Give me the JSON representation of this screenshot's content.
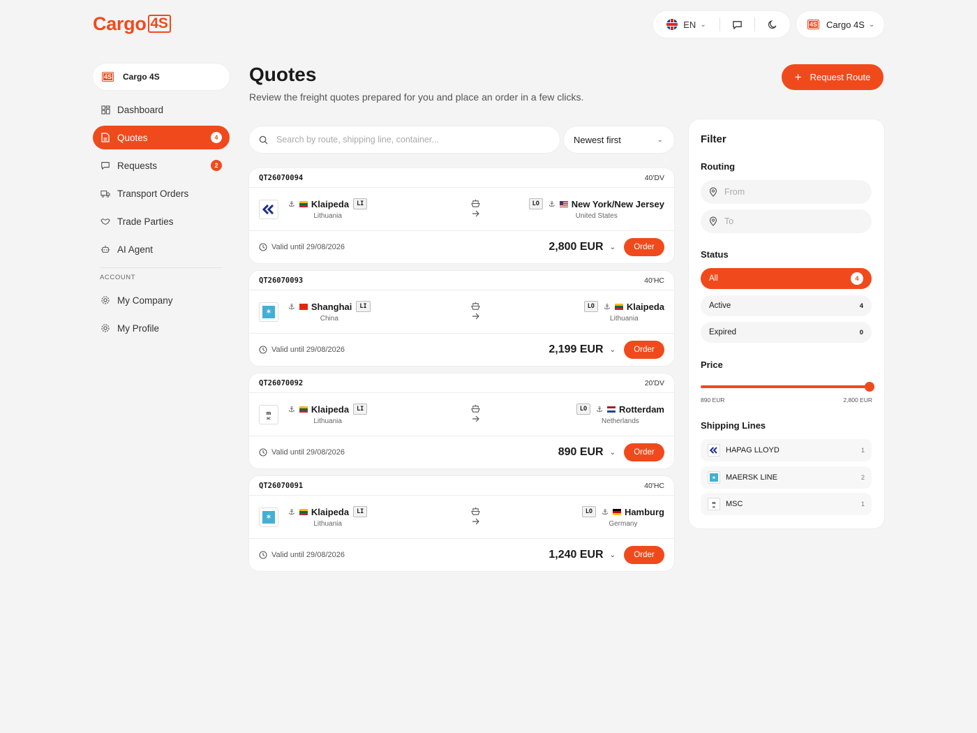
{
  "brand": {
    "logo_text": "Cargo",
    "logo_box": "4S",
    "accent": "#f04a1c"
  },
  "header": {
    "language": "EN",
    "company": "Cargo 4S",
    "company_badge": "4S",
    "icons": [
      "uk-flag-icon",
      "chat-icon",
      "moon-icon",
      "chevron-down-icon"
    ]
  },
  "sidebar": {
    "company": "Cargo 4S",
    "company_badge": "4S",
    "items": [
      {
        "label": "Dashboard",
        "icon": "dashboard-icon"
      },
      {
        "label": "Quotes",
        "icon": "document-icon",
        "badge": "4"
      },
      {
        "label": "Requests",
        "icon": "chat-icon",
        "badge": "2"
      },
      {
        "label": "Transport Orders",
        "icon": "truck-icon"
      },
      {
        "label": "Trade Parties",
        "icon": "handshake-icon"
      },
      {
        "label": "AI Agent",
        "icon": "robot-icon"
      }
    ],
    "account_label": "ACCOUNT",
    "account_items": [
      {
        "label": "My Company",
        "icon": "gear-icon"
      },
      {
        "label": "My Profile",
        "icon": "gear-icon"
      }
    ]
  },
  "main": {
    "title": "Quotes",
    "subtitle": "Review the freight quotes prepared for you and place an order in a few clicks.",
    "request_button": "Request Route",
    "search_placeholder": "Search by route, shipping line, container...",
    "sort_label": "Newest first"
  },
  "quotes": [
    {
      "id": "QT26070094",
      "container": "40'DV",
      "carrier": "hapag-lloyd-logo",
      "origin": {
        "port": "Klaipeda",
        "code": "LI",
        "country": "Lithuania",
        "flag": "lt-flag-icon"
      },
      "destination": {
        "port": "New York/New Jersey",
        "code": "LO",
        "country": "United States",
        "flag": "us-flag-icon"
      },
      "valid": "Valid until 29/08/2026",
      "price": "2,800 EUR",
      "order": "Order"
    },
    {
      "id": "QT26070093",
      "container": "40'HC",
      "carrier": "maersk-logo",
      "origin": {
        "port": "Shanghai",
        "code": "LI",
        "country": "China",
        "flag": "cn-flag-icon"
      },
      "destination": {
        "port": "Klaipeda",
        "code": "LO",
        "country": "Lithuania",
        "flag": "lt-flag-icon"
      },
      "valid": "Valid until 29/08/2026",
      "price": "2,199 EUR",
      "order": "Order"
    },
    {
      "id": "QT26070092",
      "container": "20'DV",
      "carrier": "msc-logo",
      "origin": {
        "port": "Klaipeda",
        "code": "LI",
        "country": "Lithuania",
        "flag": "lt-flag-icon"
      },
      "destination": {
        "port": "Rotterdam",
        "code": "LO",
        "country": "Netherlands",
        "flag": "nl-flag-icon"
      },
      "valid": "Valid until 29/08/2026",
      "price": "890 EUR",
      "order": "Order"
    },
    {
      "id": "QT26070091",
      "container": "40'HC",
      "carrier": "maersk-logo",
      "origin": {
        "port": "Klaipeda",
        "code": "LI",
        "country": "Lithuania",
        "flag": "lt-flag-icon"
      },
      "destination": {
        "port": "Hamburg",
        "code": "LO",
        "country": "Germany",
        "flag": "de-flag-icon"
      },
      "valid": "Valid until 29/08/2026",
      "price": "1,240 EUR",
      "order": "Order"
    }
  ],
  "filter": {
    "title": "Filter",
    "routing_label": "Routing",
    "from_placeholder": "From",
    "to_placeholder": "To",
    "status_label": "Status",
    "statuses": [
      {
        "label": "All",
        "count": "4"
      },
      {
        "label": "Active",
        "count": "4"
      },
      {
        "label": "Expired",
        "count": "0"
      }
    ],
    "price_label": "Price",
    "price_min": "890 EUR",
    "price_max": "2,800 EUR",
    "price_selected_fraction": 1.0,
    "lines_label": "Shipping Lines",
    "lines": [
      {
        "name": "HAPAG LLOYD",
        "count": "1",
        "logo": "hapag-lloyd-logo"
      },
      {
        "name": "MAERSK LINE",
        "count": "2",
        "logo": "maersk-logo"
      },
      {
        "name": "MSC",
        "count": "1",
        "logo": "msc-logo"
      }
    ]
  }
}
